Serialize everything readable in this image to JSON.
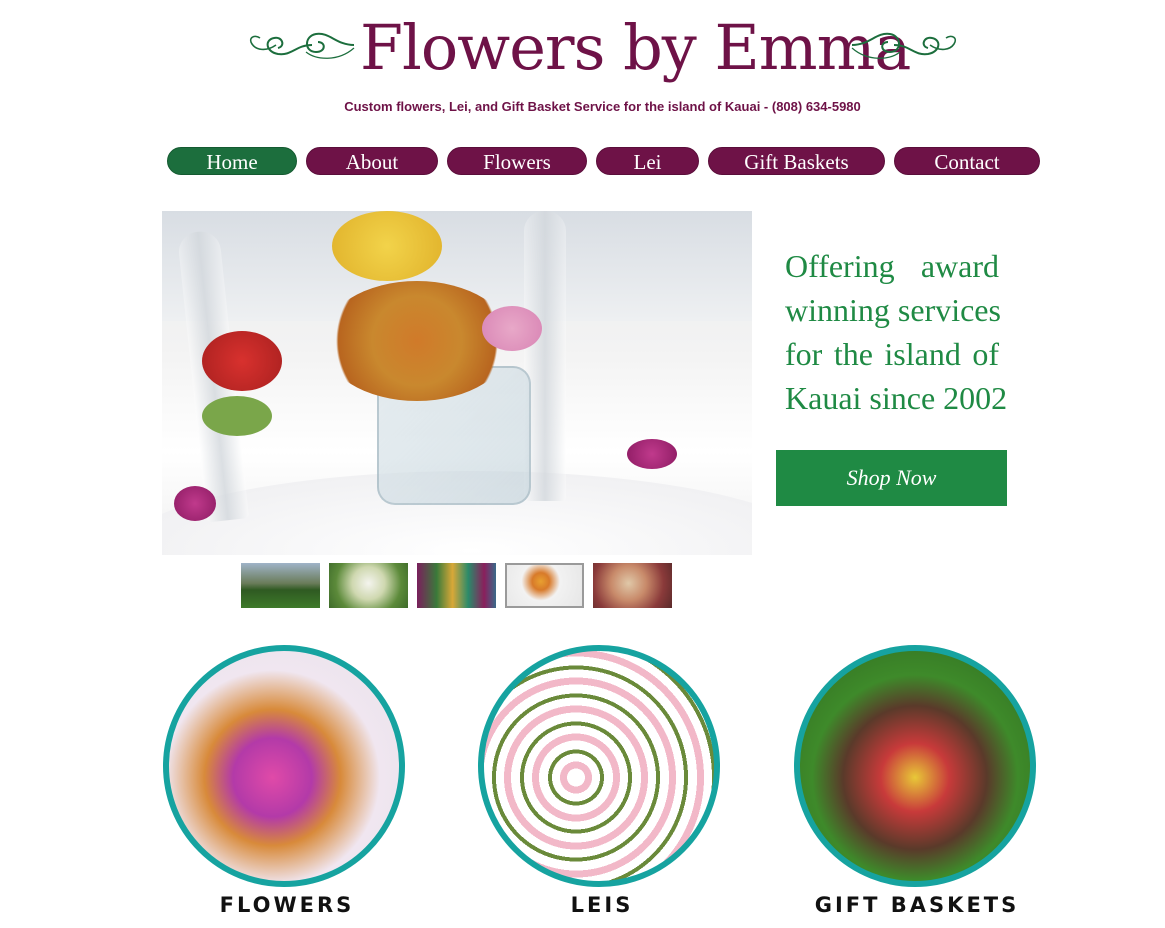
{
  "header": {
    "title": "Flowers by Emma",
    "tagline": "Custom flowers, Lei, and Gift Basket Service for the island of Kauai - (808) 634-5980",
    "colors": {
      "brand": "#6e1247",
      "accent": "#1c6e3d"
    }
  },
  "nav": {
    "items": [
      {
        "label": "Home",
        "active": true
      },
      {
        "label": "About"
      },
      {
        "label": "Flowers"
      },
      {
        "label": "Lei"
      },
      {
        "label": "Gift Baskets"
      },
      {
        "label": "Contact"
      }
    ]
  },
  "hero": {
    "offer_lines": [
      "Offering award",
      "winning services",
      "for the island of",
      "Kauai since 2002"
    ],
    "cta_label": "Shop Now",
    "selected_thumb_index": 3
  },
  "categories": [
    {
      "label": "FLOWERS"
    },
    {
      "label": "LEIS"
    },
    {
      "label": "GIFT BASKETS"
    }
  ]
}
